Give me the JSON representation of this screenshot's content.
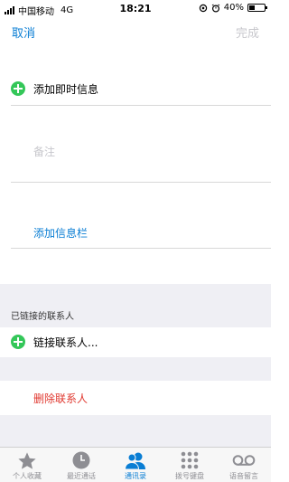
{
  "status_bar": {
    "carrier": "中国移动",
    "network": "4G",
    "time": "18:21",
    "battery_text": "40%",
    "battery_level": 0.4
  },
  "nav": {
    "cancel_label": "取消",
    "done_label": "完成"
  },
  "form": {
    "add_instant_message": "添加即时信息",
    "notes_placeholder": "备注",
    "add_field": "添加信息栏"
  },
  "linked": {
    "section_header": "已链接的联系人",
    "link_contact": "链接联系人..."
  },
  "delete_contact": "删除联系人",
  "tabbar": {
    "tabs": [
      {
        "label": "个人收藏",
        "icon": "star-icon"
      },
      {
        "label": "最近通话",
        "icon": "clock-icon"
      },
      {
        "label": "通讯录",
        "icon": "contacts-icon",
        "active": true
      },
      {
        "label": "拨号键盘",
        "icon": "keypad-icon"
      },
      {
        "label": "语音留言",
        "icon": "voicemail-icon"
      }
    ]
  },
  "colors": {
    "accent": "#0a7ed4",
    "destructive": "#e0382f",
    "add_green": "#34c759",
    "group_background": "#efeff4"
  }
}
